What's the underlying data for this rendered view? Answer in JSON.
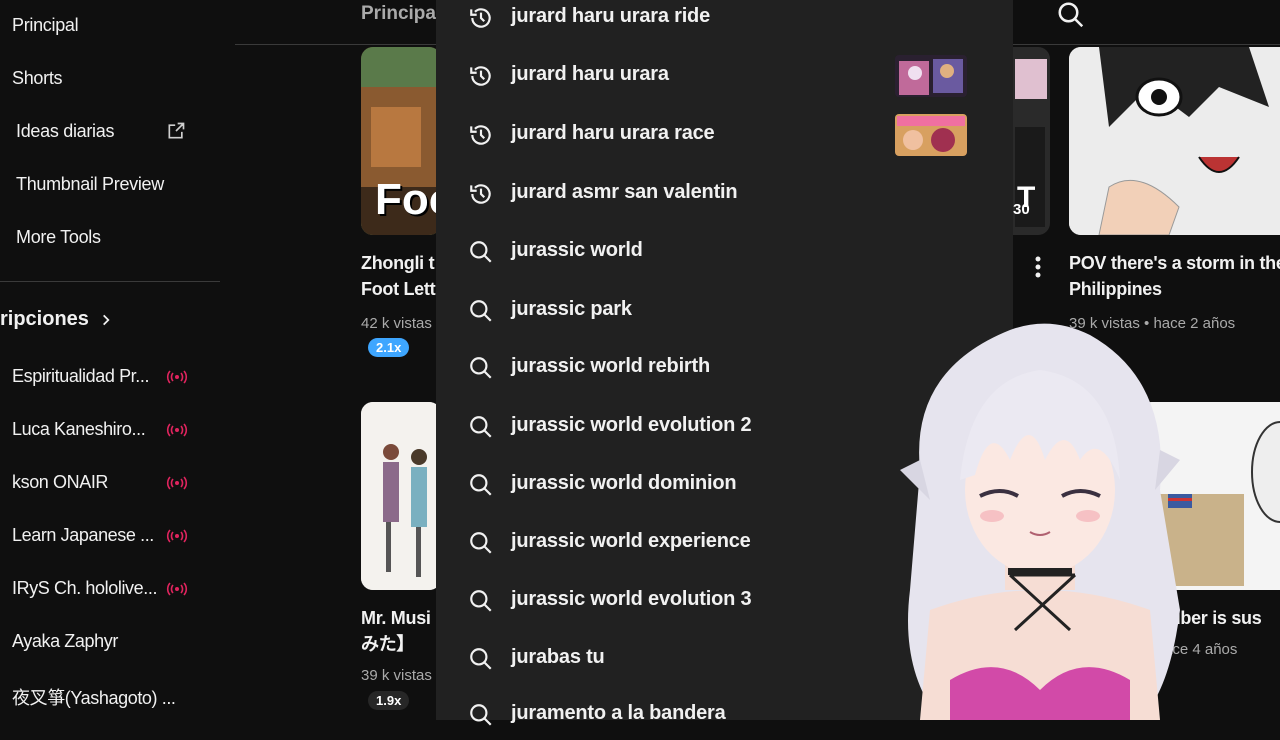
{
  "sidebar": {
    "items": [
      {
        "label": "Principal"
      },
      {
        "label": "Shorts"
      },
      {
        "label": "Ideas diarias"
      },
      {
        "label": "Thumbnail Preview"
      },
      {
        "label": "More Tools"
      }
    ],
    "subscriptions_title": "ripciones",
    "subscriptions": [
      {
        "name": "Espiritualidad Pr...",
        "live": true
      },
      {
        "name": "Luca Kaneshiro...",
        "live": true
      },
      {
        "name": "kson ONAIR",
        "live": true
      },
      {
        "name": "Learn Japanese ...",
        "live": true
      },
      {
        "name": "IRyS Ch. hololive...",
        "live": true
      },
      {
        "name": "Ayaka Zaphyr",
        "live": false
      },
      {
        "name": "夜叉箏(Yashagoto) ...",
        "live": false
      }
    ],
    "live_color": "#e0245e"
  },
  "header": {
    "tab": "Principa"
  },
  "videos": [
    {
      "title1": "Zhongli t",
      "title2": "Foot Lett",
      "meta": "42 k vistas",
      "speed": "2.1x",
      "speed_color": "#3ea6ff",
      "thumb_text": "Foo"
    },
    {
      "title1": "Mr. Musi",
      "title2": "みた】",
      "meta": "39 k vistas",
      "speed": "1.9x",
      "speed_color": "#272727"
    },
    {
      "title1": "POV there's a storm in the",
      "title2": "Philippines",
      "meta": "39 k vistas • hace 2 años"
    },
    {
      "title1": "tuber is sus",
      "meta": "ace 4 años"
    }
  ],
  "duration_partial": "30",
  "suggestions": [
    {
      "text": "jurard haru urara ride",
      "icon": "history-icon"
    },
    {
      "text": "jurard haru urara",
      "icon": "history-icon",
      "thumb": true
    },
    {
      "text": "jurard haru urara race",
      "icon": "history-icon",
      "thumb": true
    },
    {
      "text": "jurard asmr san valentin",
      "icon": "history-icon"
    },
    {
      "text": "jurassic world",
      "icon": "search-icon"
    },
    {
      "text": "jurassic park",
      "icon": "search-icon"
    },
    {
      "text": "jurassic world rebirth",
      "icon": "search-icon"
    },
    {
      "text": "jurassic world evolution 2",
      "icon": "search-icon"
    },
    {
      "text": "jurassic world dominion",
      "icon": "search-icon"
    },
    {
      "text": "jurassic world experience",
      "icon": "search-icon"
    },
    {
      "text": "jurassic world evolution 3",
      "icon": "search-icon"
    },
    {
      "text": "jurabas tu",
      "icon": "search-icon"
    },
    {
      "text": "juramento a la bandera",
      "icon": "search-icon"
    }
  ]
}
